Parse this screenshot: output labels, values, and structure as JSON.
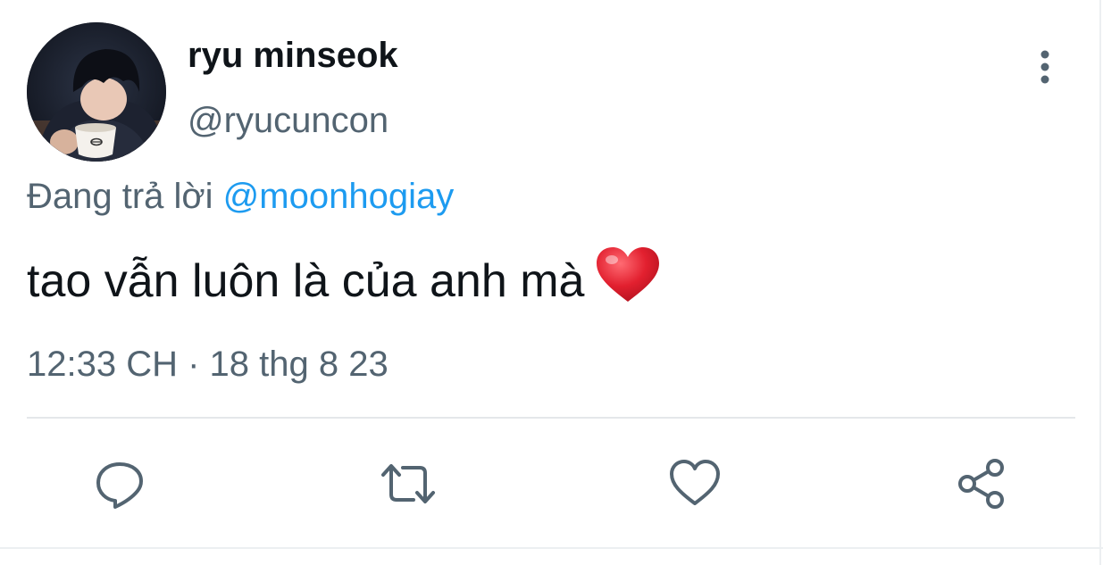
{
  "tweet": {
    "display_name": "ryu minseok",
    "handle": "@ryucuncon",
    "reply_prefix": "Đang trả lời",
    "reply_mention": "@moonhogiay",
    "text": "tao vẫn luôn là của anh mà",
    "emoji": "red-heart-emoji",
    "timestamp": "12:33 CH · 18 thg 8 23"
  },
  "actions": [
    {
      "icon": "reply-icon"
    },
    {
      "icon": "retweet-icon"
    },
    {
      "icon": "like-heart-icon"
    },
    {
      "icon": "share-icon"
    }
  ],
  "colors": {
    "primary_text": "#0f1419",
    "secondary_text": "#536471",
    "link": "#1d9bf0",
    "divider": "#e4e7ea",
    "emoji_heart": "#e2202f"
  }
}
